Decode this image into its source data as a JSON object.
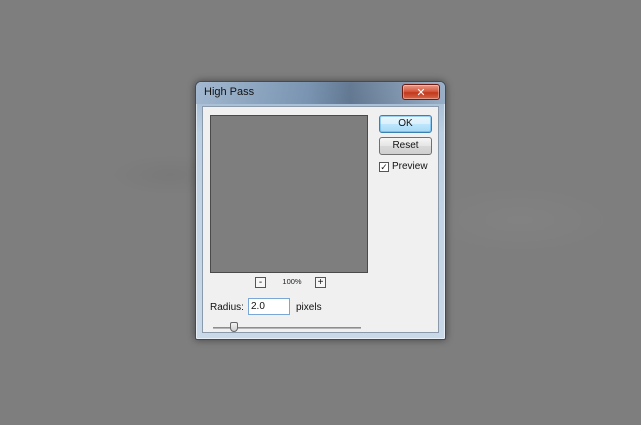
{
  "dialog": {
    "title": "High Pass",
    "close_glyph": "✕",
    "ok_label": "OK",
    "reset_label": "Reset",
    "preview_label": "Preview",
    "preview_checked": true,
    "zoom": {
      "minus": "-",
      "plus": "+",
      "level": "100%"
    },
    "radius": {
      "label": "Radius:",
      "value": "2.0",
      "unit": "pixels"
    },
    "slider_level_fraction": 0.12,
    "icons": {
      "close": "close-icon",
      "check": "checkmark-icon"
    },
    "colors": {
      "preview_gray": "#7e7e7e",
      "close_red": "#c2381c",
      "ok_blue": "#3c7fb1"
    }
  }
}
